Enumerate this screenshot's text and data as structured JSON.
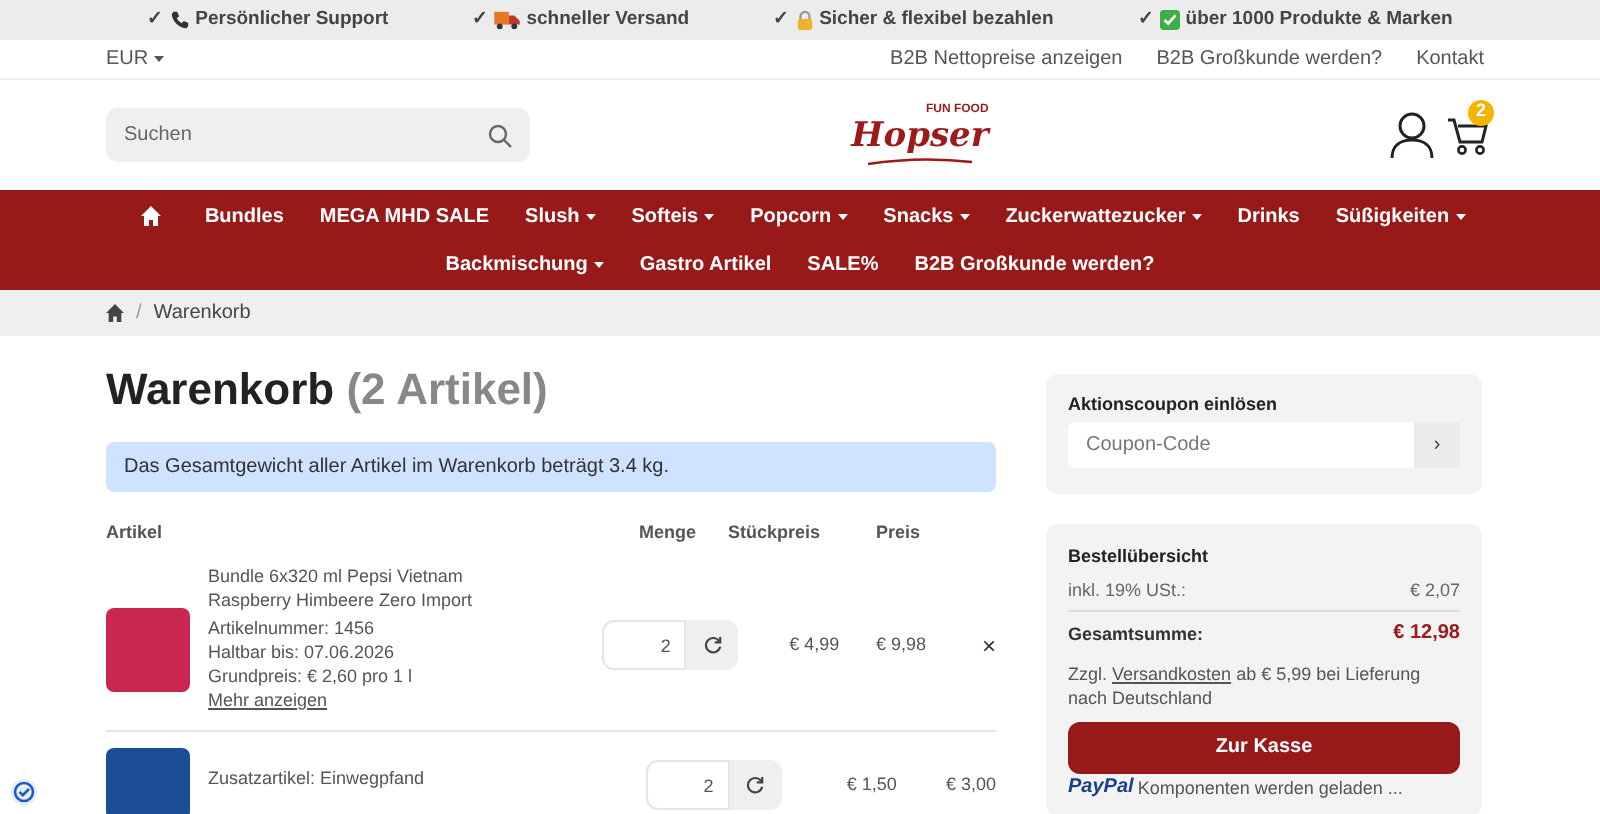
{
  "top_bar": [
    {
      "check": "✓",
      "label": "Persönlicher Support"
    },
    {
      "check": "✓",
      "label": "schneller Versand"
    },
    {
      "check": "✓",
      "label": "Sicher & flexibel bezahlen"
    },
    {
      "check": "✓",
      "label": "über 1000 Produkte & Marken"
    }
  ],
  "currency": "EUR",
  "service_links": [
    "B2B Nettopreise anzeigen",
    "B2B Großkunde werden?",
    "Kontakt"
  ],
  "search": {
    "placeholder": "Suchen"
  },
  "logo": {
    "top": "FUN FOOD",
    "main": "Hopser"
  },
  "cart_count": "2",
  "nav": [
    {
      "kind": "home"
    },
    {
      "kind": "link",
      "label": "Bundles",
      "has_menu": false
    },
    {
      "kind": "link",
      "label": "MEGA MHD SALE",
      "has_menu": false
    },
    {
      "kind": "link",
      "label": "Slush",
      "has_menu": true
    },
    {
      "kind": "link",
      "label": "Softeis",
      "has_menu": true
    },
    {
      "kind": "link",
      "label": "Popcorn",
      "has_menu": true
    },
    {
      "kind": "link",
      "label": "Snacks",
      "has_menu": true
    },
    {
      "kind": "link",
      "label": "Zuckerwattezucker",
      "has_menu": true
    },
    {
      "kind": "link",
      "label": "Drinks",
      "has_menu": false
    },
    {
      "kind": "link",
      "label": "Süßigkeiten",
      "has_menu": true
    },
    {
      "kind": "break"
    },
    {
      "kind": "link",
      "label": "Backmischung",
      "has_menu": true
    },
    {
      "kind": "link",
      "label": "Gastro Artikel",
      "has_menu": false
    },
    {
      "kind": "link",
      "label": "SALE%",
      "has_menu": false
    },
    {
      "kind": "link",
      "label": "B2B Großkunde werden?",
      "has_menu": false
    }
  ],
  "breadcrumb": {
    "separator": "/",
    "items": [
      "Warenkorb"
    ]
  },
  "heading": {
    "title": "Warenkorb",
    "count": "(2 Artikel)"
  },
  "notice": "Das Gesamtgewicht aller Artikel im Warenkorb beträgt 3.4 kg.",
  "table": {
    "columns": [
      "Artikel",
      "Menge",
      "Stückpreis",
      "Preis"
    ],
    "rows": [
      {
        "name": "Bundle 6x320 ml Pepsi Vietnam Raspberry Himbeere Zero Import",
        "details": [
          "Artikelnummer: 1456",
          "Haltbar bis: 07.06.2026",
          "Grundpreis: € 2,60 pro 1 l"
        ],
        "more": "Mehr anzeigen",
        "quantity": "2",
        "unit_price": "€ 4,99",
        "price": "€ 9,98",
        "remove": "×"
      },
      {
        "name": "Zusatzartikel: Einwegpfand",
        "details": [],
        "quantity": "2",
        "unit_price": "€ 1,50",
        "price": "€ 3,00"
      }
    ]
  },
  "coupon": {
    "title": "Aktionscoupon einlösen",
    "placeholder": "Coupon-Code",
    "button": "›"
  },
  "summary": {
    "title": "Bestellübersicht",
    "tax_label": "inkl. 19% USt.:",
    "tax": "€ 2,07",
    "total_label": "Gesamtsumme:",
    "total": "€ 12,98",
    "shipping_pre": "Zzgl.",
    "shipping_link": "Versandkosten",
    "shipping_post": "ab € 5,99 bei Lieferung nach Deutschland",
    "checkout": "Zur Kasse",
    "paypal": "PayPal",
    "paypal_note": "Komponenten werden geladen ..."
  }
}
